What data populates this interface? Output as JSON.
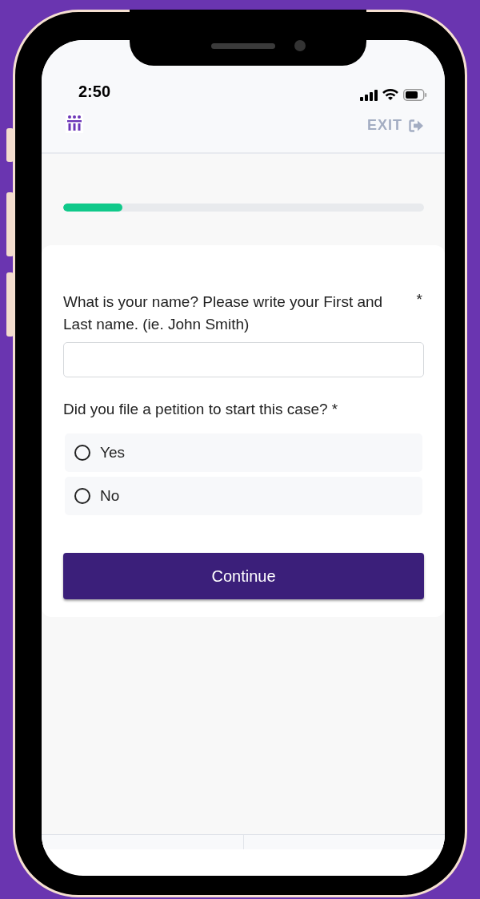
{
  "status_bar": {
    "time": "2:50"
  },
  "header": {
    "exit_label": "EXIT"
  },
  "progress": {
    "level": 0.165
  },
  "questions": [
    {
      "kind": "text",
      "label": "What is your name? Please write your First and Last name. (ie. John Smith)",
      "required_mark": "*"
    },
    {
      "kind": "radio",
      "label": "Did you file a petition to start this case?",
      "required_mark": "*",
      "options": [
        {
          "label": "Yes",
          "selected": false
        },
        {
          "label": "No",
          "selected": false
        }
      ]
    }
  ],
  "continue_button": "Continue"
}
